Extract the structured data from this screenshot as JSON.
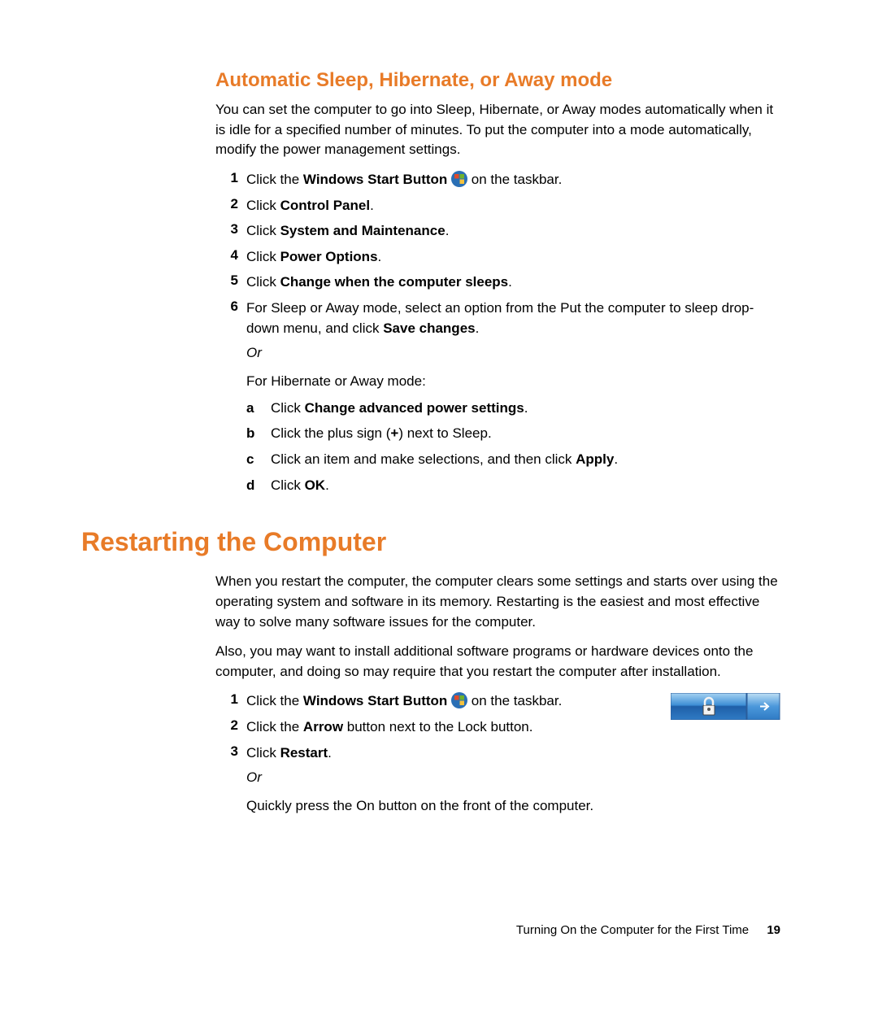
{
  "section1": {
    "heading": "Automatic Sleep, Hibernate, or Away mode",
    "intro": "You can set the computer to go into Sleep, Hibernate, or Away modes automatically when it is idle for a specified number of minutes. To put the computer into a mode automatically, modify the power management settings.",
    "steps": {
      "n1": "1",
      "s1a": "Click the ",
      "s1b": "Windows Start Button",
      "s1c": " on the taskbar.",
      "n2": "2",
      "s2a": "Click ",
      "s2b": "Control Panel",
      "s2c": ".",
      "n3": "3",
      "s3a": "Click ",
      "s3b": "System and Maintenance",
      "s3c": ".",
      "n4": "4",
      "s4a": "Click ",
      "s4b": "Power Options",
      "s4c": ".",
      "n5": "5",
      "s5a": "Click ",
      "s5b": "Change when the computer sleeps",
      "s5c": ".",
      "n6": "6",
      "s6a": "For Sleep or Away mode, select an option from the Put the computer to sleep drop-down menu, and click ",
      "s6b": "Save changes",
      "s6c": ".",
      "or": "Or",
      "hib": "For Hibernate or Away mode:",
      "sa_m": "a",
      "sa_a": "Click ",
      "sa_b": "Change advanced power settings",
      "sa_c": ".",
      "sb_m": "b",
      "sb_a": "Click the plus sign (",
      "sb_b": "+",
      "sb_c": ") next to Sleep.",
      "sc_m": "c",
      "sc_a": "Click an item and make selections, and then click ",
      "sc_b": "Apply",
      "sc_c": ".",
      "sd_m": "d",
      "sd_a": "Click ",
      "sd_b": "OK",
      "sd_c": "."
    }
  },
  "section2": {
    "heading": "Restarting the Computer",
    "p1": "When you restart the computer, the computer clears some settings and starts over using the operating system and software in its memory. Restarting is the easiest and most effective way to solve many software issues for the computer.",
    "p2": "Also, you may want to install additional software programs or hardware devices onto the computer, and doing so may require that you restart the computer after installation.",
    "steps": {
      "n1": "1",
      "s1a": "Click the ",
      "s1b": "Windows Start Button",
      "s1c": " on the taskbar.",
      "n2": "2",
      "s2a": "Click the ",
      "s2b": "Arrow",
      "s2c": " button next to the Lock button.",
      "n3": "3",
      "s3a": "Click ",
      "s3b": "Restart",
      "s3c": ".",
      "or": "Or",
      "alt": "Quickly press the On button on the front of the computer."
    }
  },
  "footer": {
    "chapter": "Turning On the Computer for the First Time",
    "page": "19"
  }
}
